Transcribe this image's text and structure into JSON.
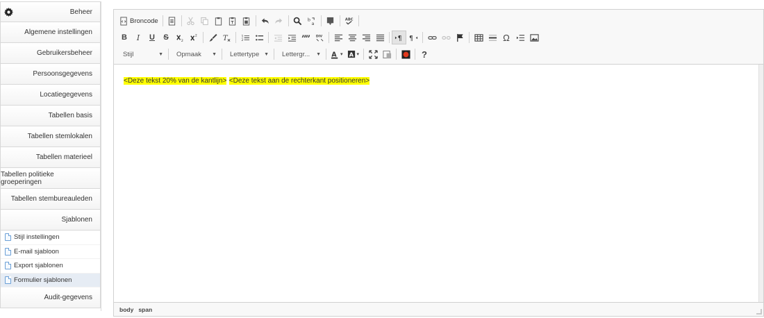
{
  "sidebar": {
    "title": "Beheer",
    "items": [
      "Algemene instellingen",
      "Gebruikersbeheer",
      "Persoonsgegevens",
      "Locatiegegevens",
      "Tabellen basis",
      "Tabellen stemlokalen",
      "Tabellen materieel",
      "Tabellen politieke groeperingen",
      "Tabellen stembureauleden",
      "Sjablonen"
    ],
    "sub_items": [
      "Stijl instellingen",
      "E-mail sjabloon",
      "Export sjablonen",
      "Formulier sjablonen"
    ],
    "active_sub": "Formulier sjablonen",
    "last_item": "Audit-gegevens"
  },
  "toolbar": {
    "source_label": "Broncode",
    "bold": "B",
    "italic": "I",
    "underline": "U",
    "strike": "S",
    "omega": "Ω",
    "help": "?",
    "styles_combo": "Stijl",
    "format_combo": "Opmaak",
    "font_combo": "Lettertype",
    "size_combo": "Lettergr..."
  },
  "content": {
    "text1": "<Deze tekst 20% van de kantlijn>",
    "text2": "<Deze tekst aan de rechterkant positioneren>"
  },
  "statusbar": {
    "path": [
      "body",
      "span"
    ]
  },
  "colors": {
    "highlight": "#ffff00",
    "accent": "#6a9fd6"
  }
}
